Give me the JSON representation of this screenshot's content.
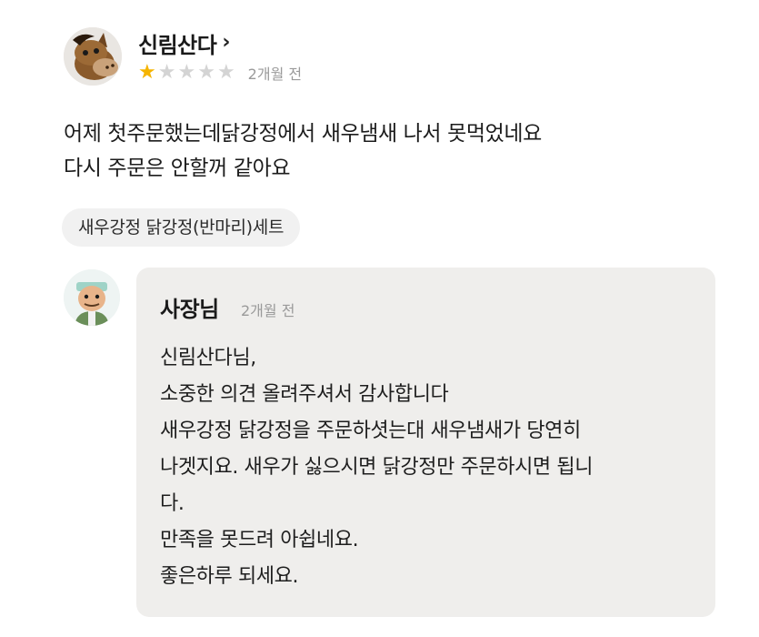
{
  "review": {
    "reviewer_name": "신림산다",
    "chevron": "›",
    "rating": 1,
    "rating_max": 5,
    "time": "2개월 전",
    "text_lines": [
      "어제 첫주문했는데닭강정에서 새우냄새 나서 못먹었네요",
      "다시 주문은 안할꺼 같아요"
    ],
    "menu_tag": "새우강정 닭강정(반마리)세트"
  },
  "reply": {
    "owner_name": "사장님",
    "time": "2개월 전",
    "text_lines": [
      "신림산다님,",
      "소중한 의견 올려주셔서 감사합니다",
      "새우강정 닭강정을 주문하셧는대  새우냄새가 당연히",
      "나겟지요. 새우가 싫으시면 닭강정만 주문하시면 됩니",
      "다.",
      "만족을 못드려 아쉽네요.",
      "좋은하루 되세요."
    ]
  },
  "colors": {
    "star_filled": "#f5b400",
    "star_empty": "#d4d4d4",
    "reply_background": "#efeeec",
    "tag_background": "#f1f1f1"
  },
  "icons": {
    "reviewer_avatar": "horse-avatar-icon",
    "owner_avatar": "owner-avatar-icon",
    "star": "star-icon"
  }
}
